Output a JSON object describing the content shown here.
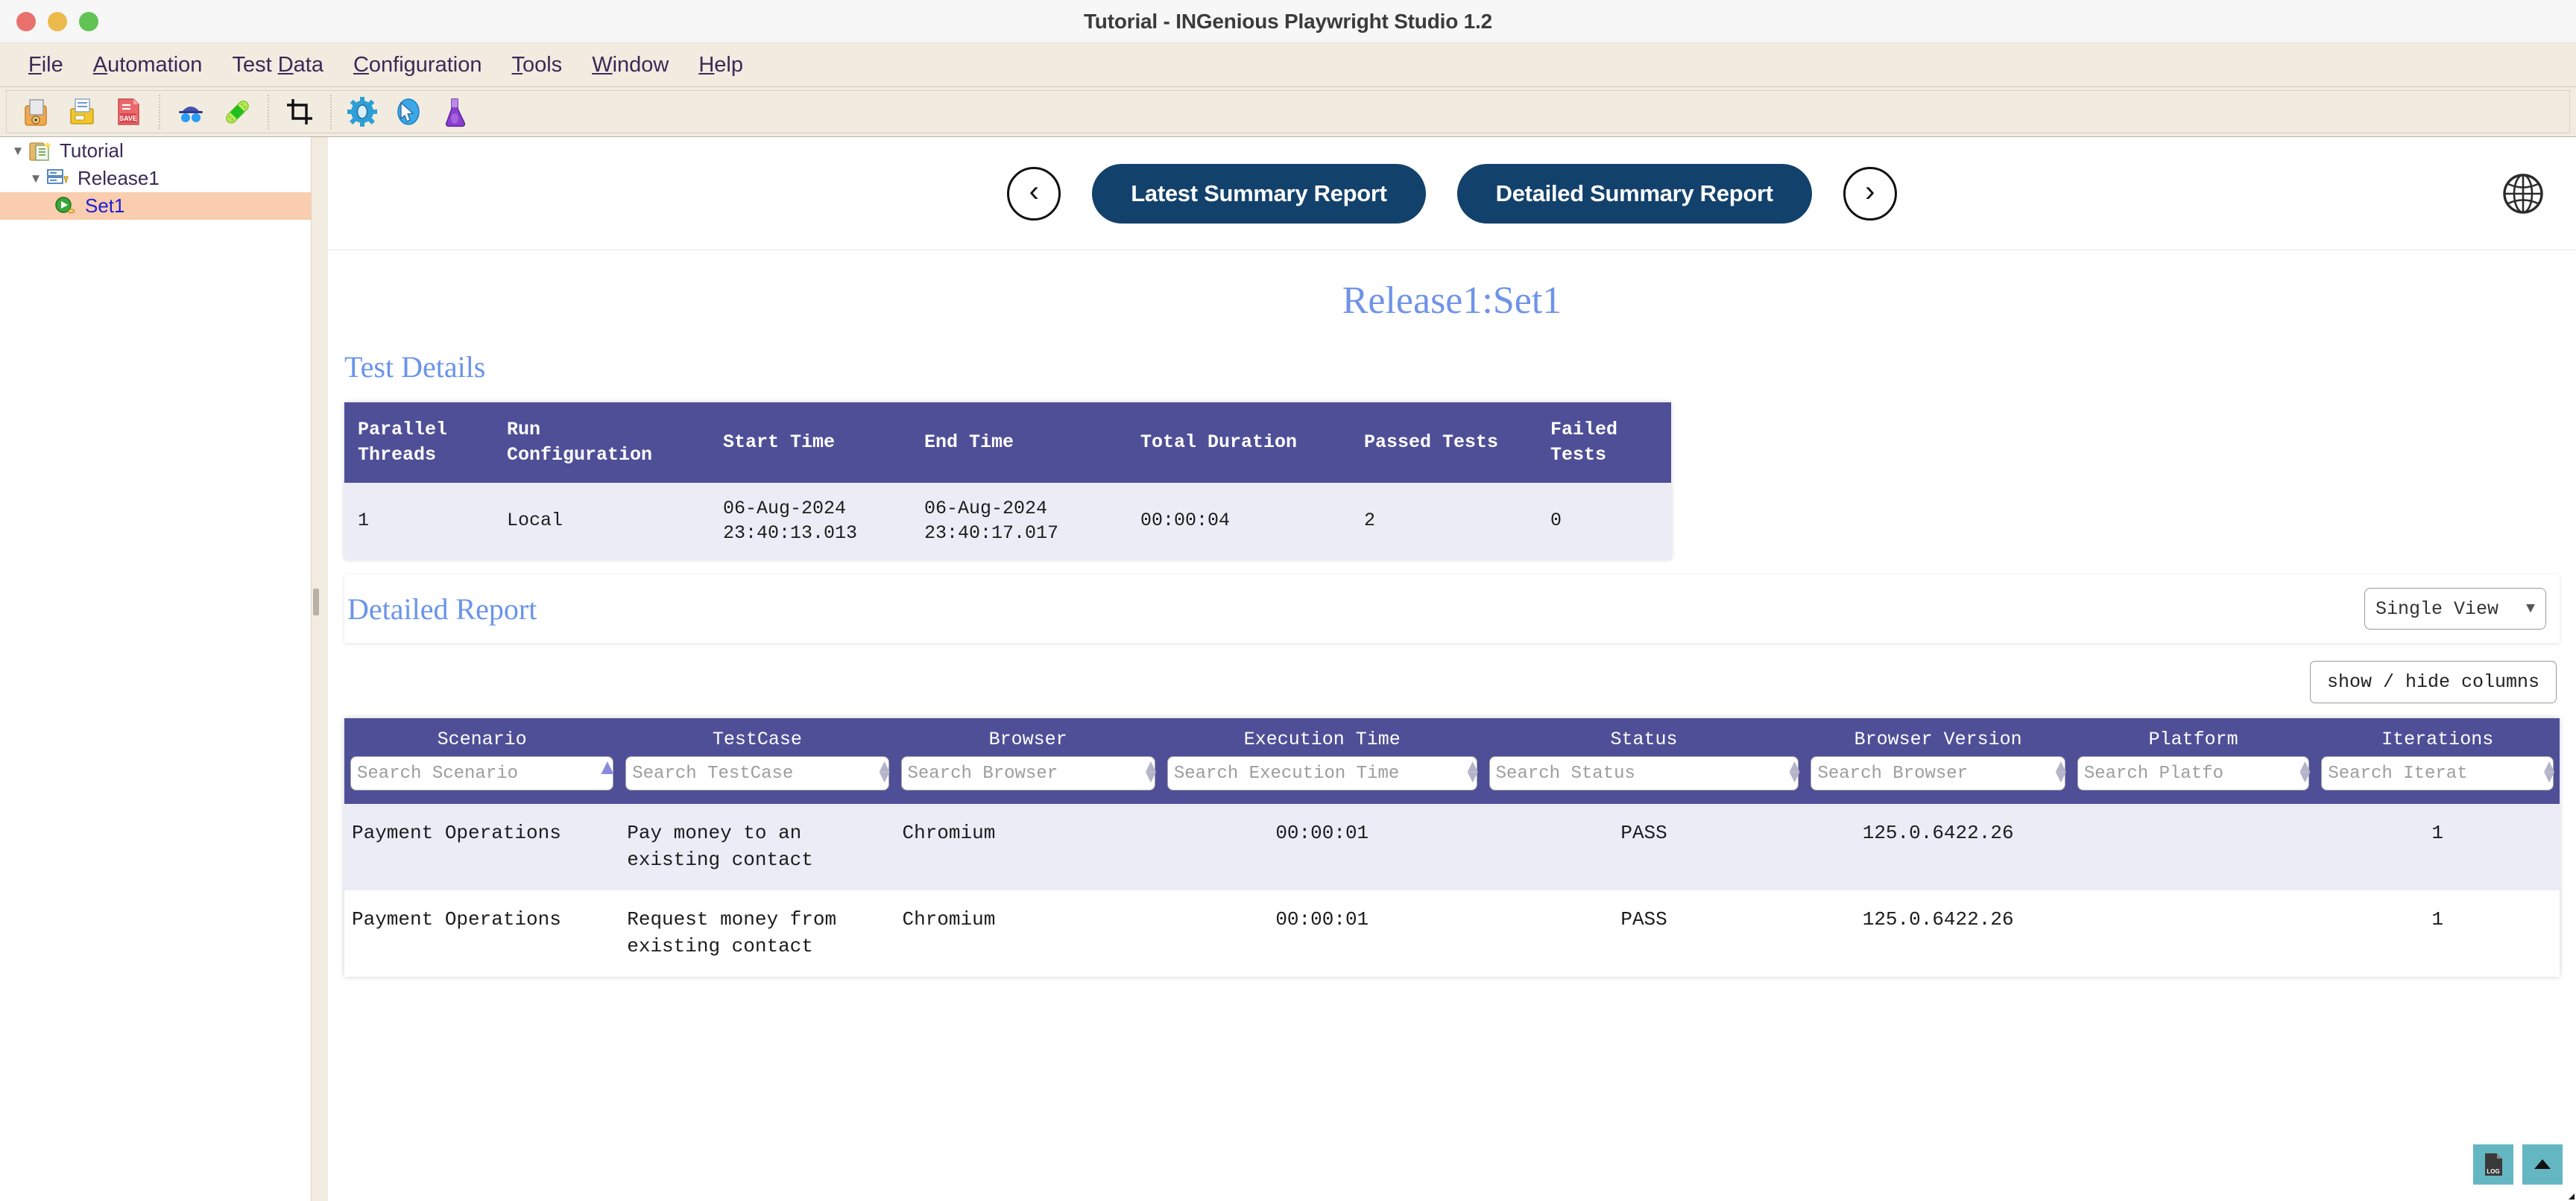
{
  "window": {
    "title": "Tutorial - INGenious Playwright Studio 1.2",
    "traffic_lights": [
      "close",
      "minimize",
      "maximize"
    ]
  },
  "menubar": {
    "items": [
      {
        "label": "File",
        "accel": "F"
      },
      {
        "label": "Automation",
        "accel": "A"
      },
      {
        "label": "Test Data",
        "accel": "D"
      },
      {
        "label": "Configuration",
        "accel": "C"
      },
      {
        "label": "Tools",
        "accel": "T"
      },
      {
        "label": "Window",
        "accel": "W"
      },
      {
        "label": "Help",
        "accel": "H"
      }
    ]
  },
  "toolbar": {
    "buttons": [
      {
        "name": "open-project-icon",
        "title": "Open Project"
      },
      {
        "name": "open-file-icon",
        "title": "Open File"
      },
      {
        "name": "save-icon",
        "title": "Save"
      },
      {
        "name": "spy-icon",
        "title": "Object Spy"
      },
      {
        "name": "bandage-icon",
        "title": "Heal"
      },
      {
        "name": "crop-icon",
        "title": "Capture"
      },
      {
        "name": "gear-icon",
        "title": "Settings"
      },
      {
        "name": "browser-pointer-icon",
        "title": "Browser"
      },
      {
        "name": "flask-icon",
        "title": "Test Lab"
      }
    ]
  },
  "sidebar": {
    "tree": [
      {
        "label": "Tutorial",
        "level": 0,
        "expanded": true,
        "icon": "project-icon",
        "selected": false
      },
      {
        "label": "Release1",
        "level": 1,
        "expanded": true,
        "icon": "release-icon",
        "selected": false
      },
      {
        "label": "Set1",
        "level": 2,
        "expanded": null,
        "icon": "run-set-icon",
        "selected": true
      }
    ]
  },
  "report_header": {
    "prev_label": "‹",
    "next_label": "›",
    "latest_summary_label": "Latest Summary Report",
    "detailed_summary_label": "Detailed Summary Report",
    "globe_title": "Open in Browser"
  },
  "page": {
    "title": "Release1:Set1",
    "test_details_heading": "Test Details",
    "detailed_report_heading": "Detailed Report"
  },
  "test_details": {
    "columns": [
      "Parallel Threads",
      "Run Configuration",
      "Start Time",
      "End Time",
      "Total Duration",
      "Passed Tests",
      "Failed Tests"
    ],
    "row": {
      "parallel_threads": "1",
      "run_configuration": "Local",
      "start_time_date": "06-Aug-2024",
      "start_time_clock": "23:40:13.013",
      "end_time_date": "06-Aug-2024",
      "end_time_clock": "23:40:17.017",
      "total_duration": "00:00:04",
      "passed_tests": "2",
      "failed_tests": "0"
    }
  },
  "controls": {
    "view_mode": "Single View",
    "view_caret": "▼",
    "show_hide_columns": "show / hide columns"
  },
  "detailed_report": {
    "columns": [
      {
        "label": "Scenario",
        "placeholder": "Search Scenario",
        "sort": "asc"
      },
      {
        "label": "TestCase",
        "placeholder": "Search TestCase",
        "sort": "none"
      },
      {
        "label": "Browser",
        "placeholder": "Search Browser",
        "sort": "none"
      },
      {
        "label": "Execution Time",
        "placeholder": "Search Execution Time",
        "sort": "none"
      },
      {
        "label": "Status",
        "placeholder": "Search Status",
        "sort": "none"
      },
      {
        "label": "Browser Version",
        "placeholder": "Search Browser",
        "sort": "none"
      },
      {
        "label": "Platform",
        "placeholder": "Search Platfo",
        "sort": "none"
      },
      {
        "label": "Iterations",
        "placeholder": "Search Iterat",
        "sort": "none"
      }
    ],
    "rows": [
      {
        "scenario": "Payment Operations",
        "testcase": "Pay money to an existing contact",
        "browser": "Chromium",
        "execution_time": "00:00:01",
        "status": "PASS",
        "browser_version": "125.0.6422.26",
        "platform": "",
        "iterations": "1"
      },
      {
        "scenario": "Payment Operations",
        "testcase": "Request money from existing contact",
        "browser": "Chromium",
        "execution_time": "00:00:01",
        "status": "PASS",
        "browser_version": "125.0.6422.26",
        "platform": "",
        "iterations": "1"
      }
    ]
  },
  "fabs": [
    {
      "name": "log-file-icon",
      "label": "LOG"
    },
    {
      "name": "scroll-to-top-icon",
      "label": "▲"
    }
  ],
  "colors": {
    "accent_navy": "#12416c",
    "table_header_purple": "#4f4f98",
    "row_alt": "#ececf7",
    "link_blue": "#5b8bdd",
    "heading_blue": "#6a94ea",
    "pass_green": "#0f9b0f",
    "fail_red": "#e01b1b",
    "selection_peach": "#f9cdae",
    "chrome_beige": "#f2ebe0",
    "fab_teal": "#64b7c2"
  }
}
